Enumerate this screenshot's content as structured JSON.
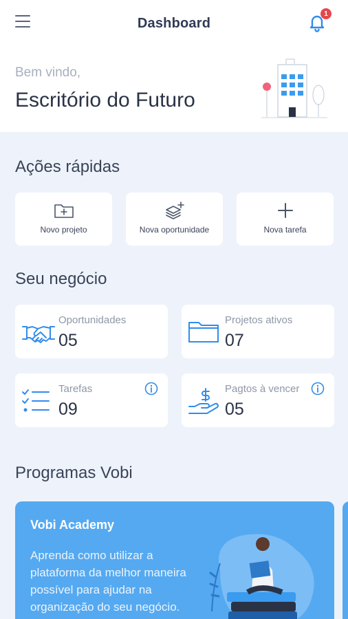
{
  "header": {
    "title": "Dashboard",
    "notification_count": "1"
  },
  "welcome": {
    "greeting": "Bem vindo,",
    "company": "Escritório do Futuro"
  },
  "quick_actions": {
    "title": "Ações rápidas",
    "items": [
      {
        "label": "Novo projeto",
        "icon": "folder-plus-icon"
      },
      {
        "label": "Nova oportunidade",
        "icon": "layers-plus-icon"
      },
      {
        "label": "Nova tarefa",
        "icon": "plus-icon"
      }
    ]
  },
  "business": {
    "title": "Seu negócio",
    "stats": [
      {
        "label": "Oportunidades",
        "value": "05",
        "icon": "handshake-icon"
      },
      {
        "label": "Projetos ativos",
        "value": "07",
        "icon": "folder-icon"
      },
      {
        "label": "Tarefas",
        "value": "09",
        "icon": "checklist-icon"
      },
      {
        "label": "Pagtos à vencer",
        "value": "05",
        "icon": "money-hand-icon"
      }
    ]
  },
  "programs": {
    "title": "Programas Vobi",
    "card": {
      "title": "Vobi Academy",
      "text": "Aprenda como utilizar a plataforma da melhor maneira possível para ajudar na organização do seu negócio."
    }
  },
  "colors": {
    "accent": "#3A9BEF",
    "background": "#EEF3FB",
    "promo": "#55A9F0",
    "badge": "#E5474B"
  }
}
